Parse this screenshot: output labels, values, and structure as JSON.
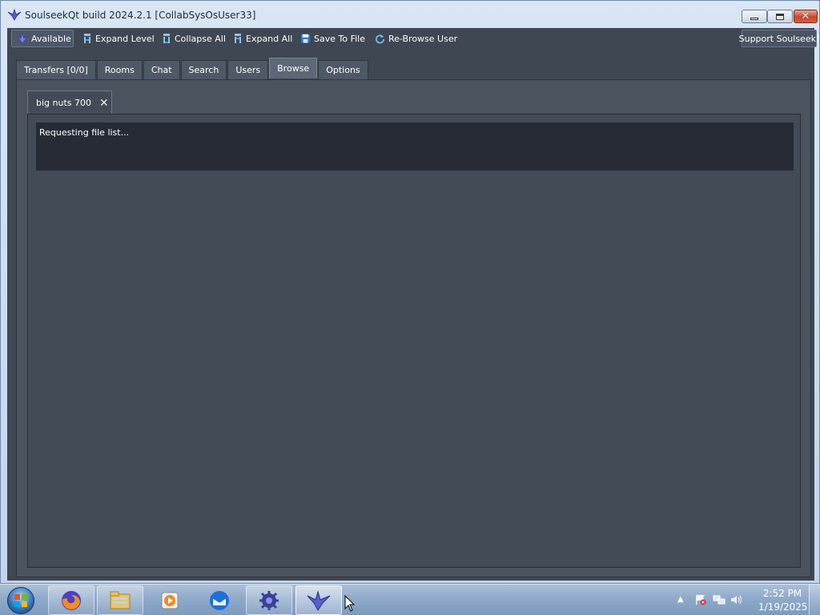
{
  "window": {
    "title": "SoulseekQt build 2024.2.1 [CollabSysOsUser33]",
    "close_glyph": "✕"
  },
  "toolbar": {
    "status_label": "Available",
    "expand_level_label": "Expand Level",
    "collapse_all_label": "Collapse All",
    "expand_all_label": "Expand All",
    "save_to_file_label": "Save To File",
    "rebrowse_label": "Re-Browse User",
    "support_label": "Support Soulseek!"
  },
  "tabs": [
    {
      "label": "Transfers [0/0]"
    },
    {
      "label": "Rooms"
    },
    {
      "label": "Chat"
    },
    {
      "label": "Search"
    },
    {
      "label": "Users"
    },
    {
      "label": "Browse",
      "active": true
    },
    {
      "label": "Options"
    }
  ],
  "browse": {
    "user_tab_label": "big nuts 700",
    "close_glyph": "✕",
    "status_text": "Requesting file list..."
  },
  "taskbar": {
    "items": [
      "firefox-icon",
      "file-explorer-icon",
      "media-player-icon",
      "thunderbird-icon",
      "app-gear-icon",
      "soulseek-icon"
    ],
    "clock_time": "2:52 PM",
    "clock_date": "1/19/2025"
  },
  "colors": {
    "app_background": "#3f4752",
    "status_box": "#262b36",
    "taskbar": "#8faac9"
  }
}
